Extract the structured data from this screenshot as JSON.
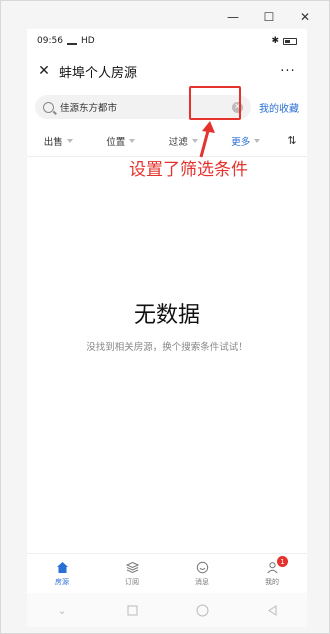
{
  "window": {
    "minimize_glyph": "—",
    "maximize_glyph": "☐",
    "close_glyph": "✕"
  },
  "status": {
    "time": "09:56",
    "network": "HD"
  },
  "header": {
    "title": "蚌埠个人房源",
    "close_glyph": "✕",
    "more_glyph": "···"
  },
  "search": {
    "value": "佳源东方都市",
    "favorites_label": "我的收藏"
  },
  "filters": [
    {
      "label": "出售",
      "active": false
    },
    {
      "label": "位置",
      "active": false
    },
    {
      "label": "过滤",
      "active": false
    },
    {
      "label": "更多",
      "active": true
    }
  ],
  "sort_glyph": "⇅",
  "annotation": {
    "text": "设置了筛选条件",
    "color": "#e5322d"
  },
  "empty": {
    "title": "无数据",
    "subtitle": "没找到相关房源，换个搜索条件试试！"
  },
  "tabbar": {
    "tabs": [
      {
        "label": "房源",
        "icon": "home-icon",
        "active": true
      },
      {
        "label": "订阅",
        "icon": "layers-icon",
        "active": false
      },
      {
        "label": "消息",
        "icon": "chat-icon",
        "active": false
      },
      {
        "label": "我的",
        "icon": "user-icon",
        "active": false,
        "badge": "1"
      }
    ]
  },
  "colors": {
    "accent": "#2a6fd6",
    "annotation": "#e5322d"
  }
}
